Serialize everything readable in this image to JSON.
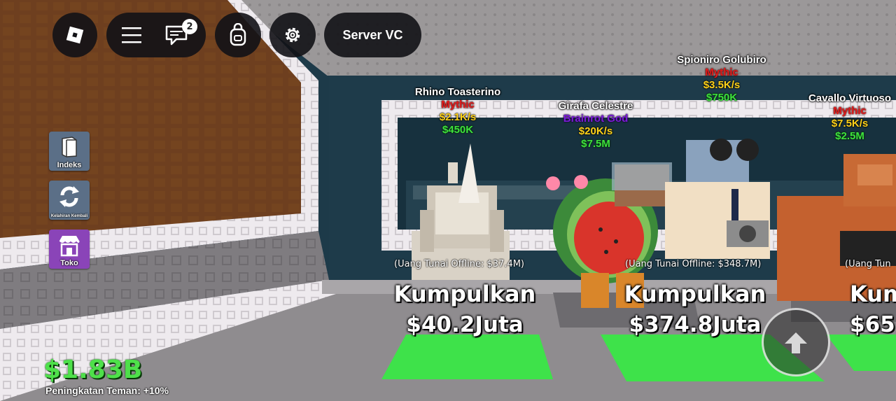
{
  "toolbar": {
    "icons": [
      "roblox-logo-icon",
      "menu-icon",
      "chat-icon",
      "backpack-icon",
      "gear-icon"
    ],
    "chat_badge": "2",
    "server_vc_label": "Server VC"
  },
  "side_menu": [
    {
      "label": "Indeks",
      "icon": "book-icon",
      "color": "#5b6f87"
    },
    {
      "label": "Kelahiran Kembali",
      "icon": "rebirth-icon",
      "color": "#5b6f87"
    },
    {
      "label": "Toko",
      "icon": "shop-icon",
      "color": "#8a44b8"
    }
  ],
  "brainrots": [
    {
      "name": "Rhino Toasterino",
      "rarity": "Mythic",
      "rate": "$2.1K/s",
      "price": "$450K"
    },
    {
      "name": "Girafa Celestre",
      "rarity": "Brainrot God",
      "rate": "$20K/s",
      "price": "$7.5M"
    },
    {
      "name": "Spioniro Golubiro",
      "rarity": "Mythic",
      "rate": "$3.5K/s",
      "price": "$750K"
    },
    {
      "name": "Cavallo Virtuoso",
      "rarity": "Mythic",
      "rate": "$7.5K/s",
      "price": "$2.5M"
    }
  ],
  "collectors": [
    {
      "offline": "(Uang Tunai Offline: $37.4M)",
      "label": "Kumpulkan",
      "amount": "$40.2Juta"
    },
    {
      "offline": "(Uang Tunai Offline: $348.7M)",
      "label": "Kumpulkan",
      "amount": "$374.8Juta"
    },
    {
      "offline": "(Uang Tun",
      "label": "Kum",
      "amount": "$65"
    }
  ],
  "hud": {
    "money": "$1.83B",
    "friend_boost": "Peningkatan Teman: +10%",
    "jump_icon": "jump-arrow-icon"
  },
  "colors": {
    "money_green": "#4ee04a",
    "mythic_red": "#e21b1b",
    "god_purple": "#7a1dd6",
    "rate_yellow": "#ffd21a",
    "pad_green": "#3ee24a"
  }
}
